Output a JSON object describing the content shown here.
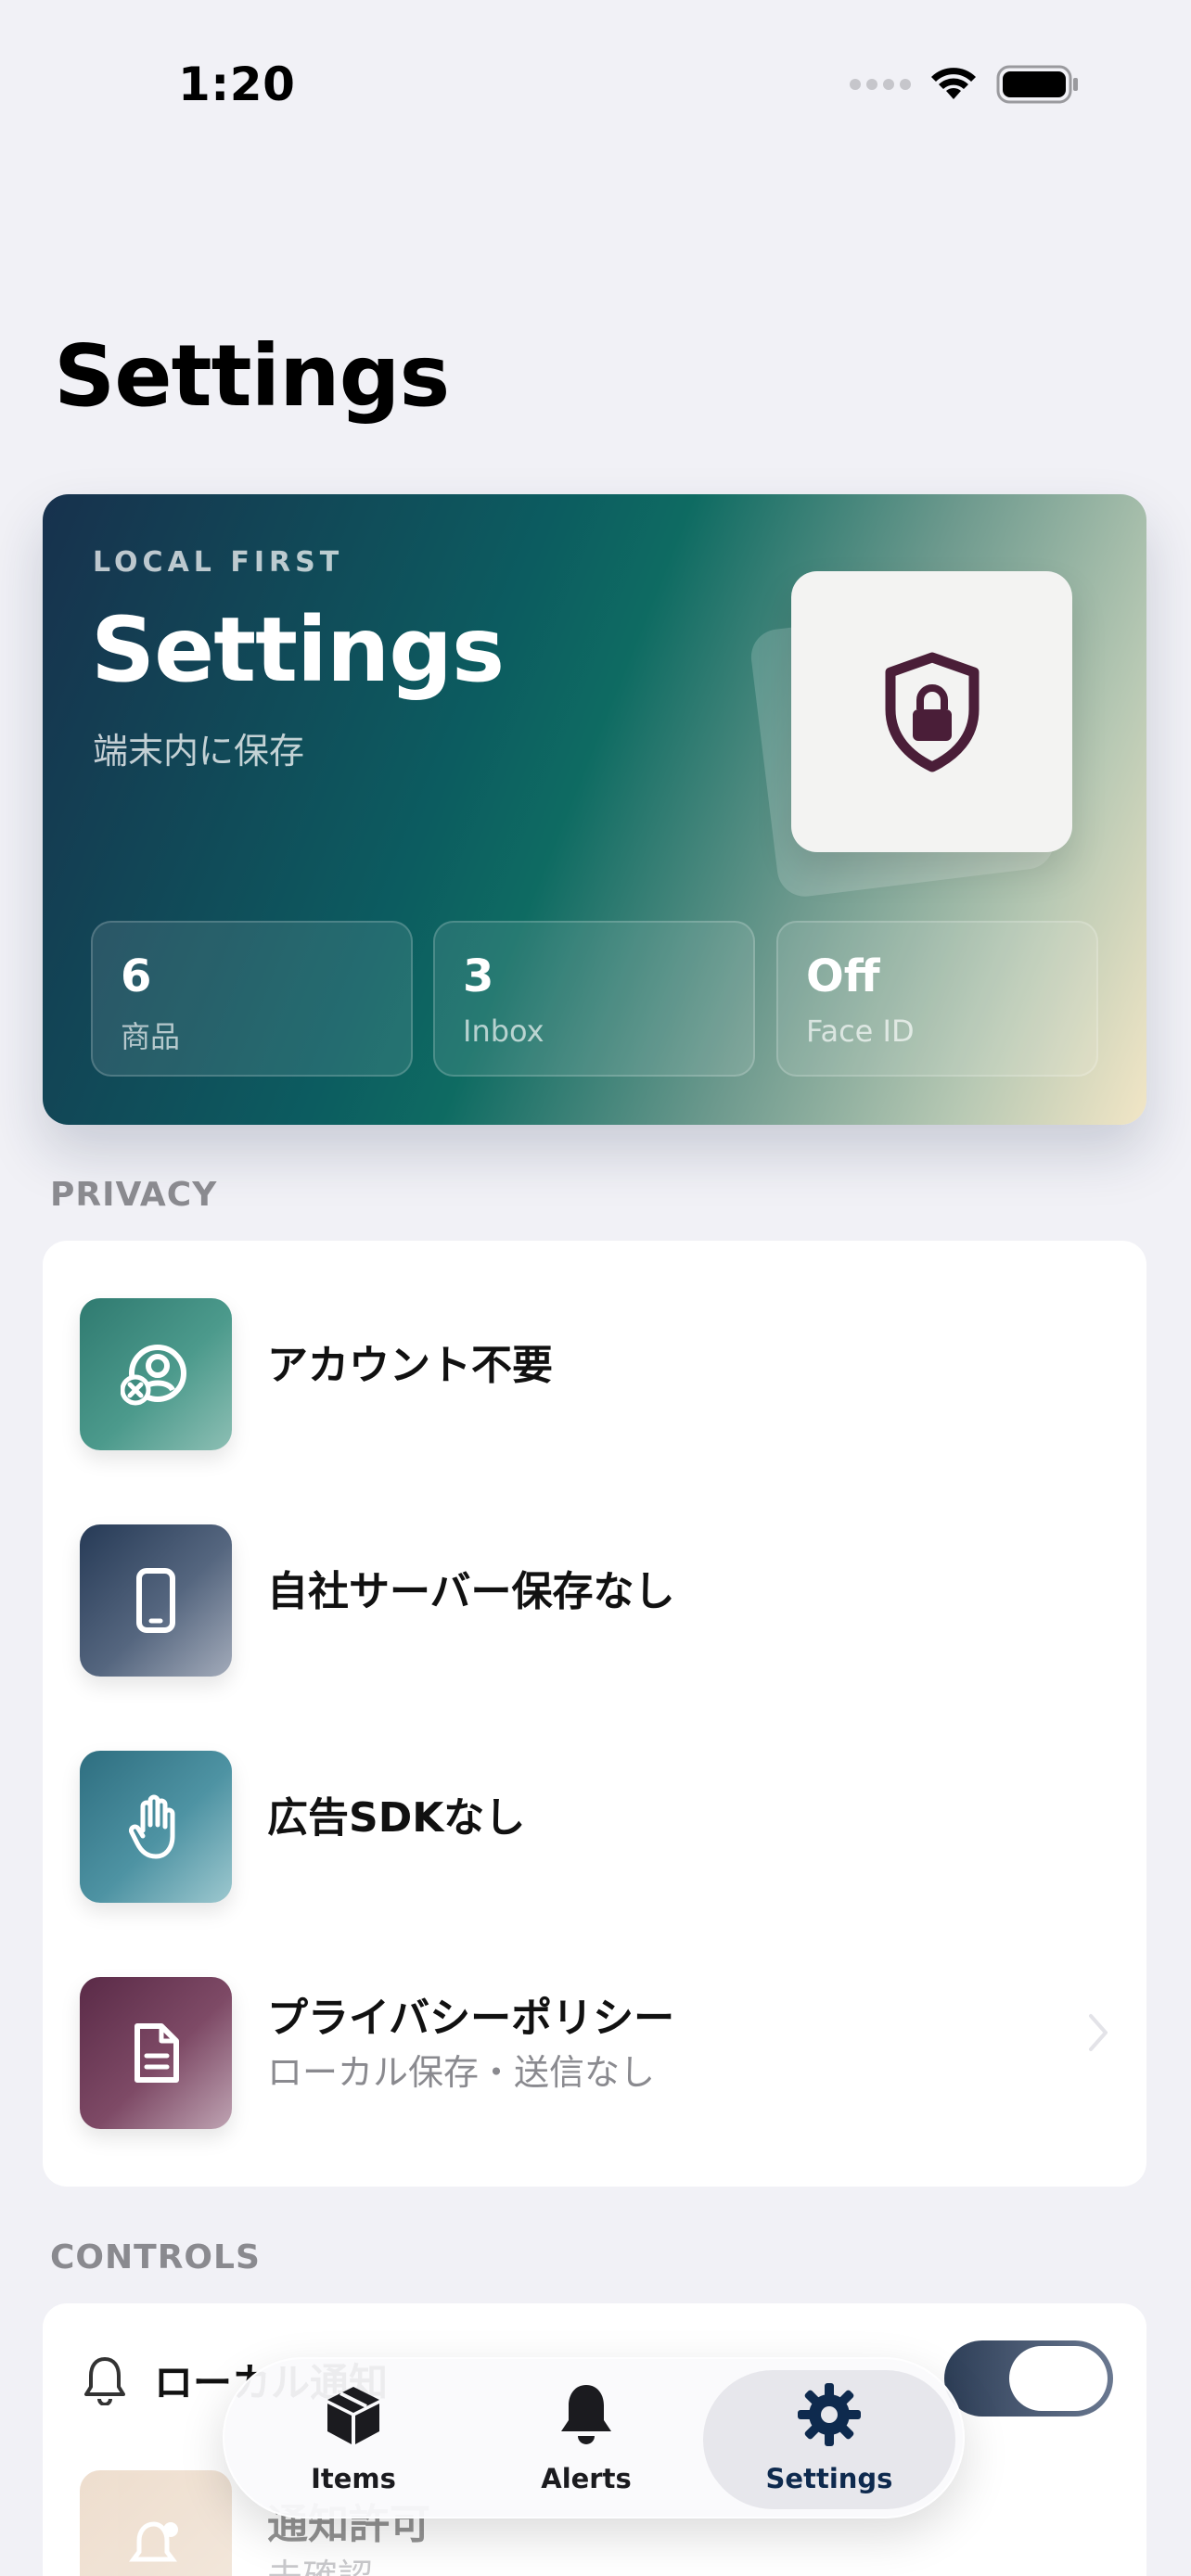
{
  "status_bar": {
    "time": "1:20"
  },
  "nav": {
    "large_title": "Settings"
  },
  "hero": {
    "eyebrow": "LOCAL FIRST",
    "title": "Settings",
    "subtitle": "端末内に保存",
    "icon": "shield-lock-icon",
    "stats": [
      {
        "value": "6",
        "label": "商品"
      },
      {
        "value": "3",
        "label": "Inbox"
      },
      {
        "value": "Off",
        "label": "Face ID"
      }
    ]
  },
  "privacy": {
    "header": "PRIVACY",
    "rows": [
      {
        "title": "アカウント不要",
        "icon": "no-account-icon"
      },
      {
        "title": "自社サーバー保存なし",
        "icon": "phone-icon"
      },
      {
        "title": "広告SDKなし",
        "icon": "raised-hand-icon"
      },
      {
        "title": "プライバシーポリシー",
        "subtitle": "ローカル保存・送信なし",
        "icon": "document-icon"
      }
    ]
  },
  "controls": {
    "header": "CONTROLS",
    "notification_label": "ローカル通知",
    "notification_toggle_on": true,
    "permission_title": "通知許可",
    "permission_subtitle": "未確認"
  },
  "tabbar": {
    "items": [
      {
        "label": "Items",
        "icon": "package-icon"
      },
      {
        "label": "Alerts",
        "icon": "bell-icon"
      },
      {
        "label": "Settings",
        "icon": "gear-icon"
      }
    ],
    "selected": "Settings"
  },
  "colors": {
    "background": "#F1F1F6",
    "accent": "#0E2A4E",
    "hero_gradient_start": "#17314D",
    "hero_gradient_mid": "#0E6B62",
    "hero_gradient_end": "#F2E6C6"
  }
}
